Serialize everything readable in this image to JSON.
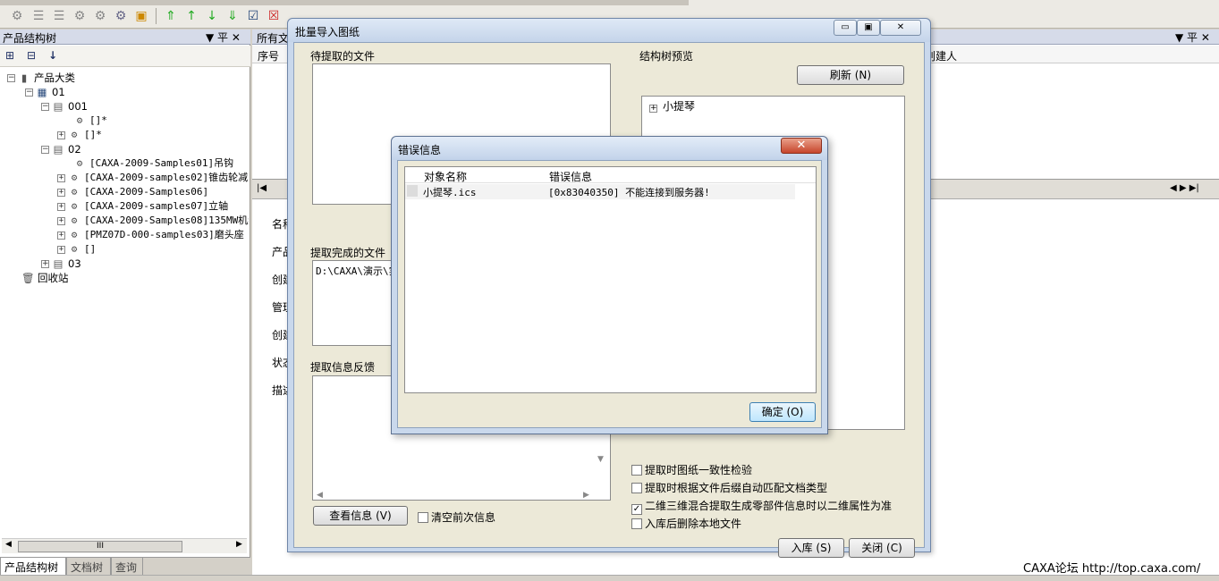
{
  "left_panel": {
    "title": "产品结构树",
    "pin": "▼ 平 ✕",
    "tree": [
      {
        "label": "产品大类"
      },
      {
        "label": "01"
      },
      {
        "label": "001"
      },
      {
        "label": "[]*"
      },
      {
        "label": "[]*"
      },
      {
        "label": "02"
      },
      {
        "label": "[CAXA-2009-Samples01]吊钩"
      },
      {
        "label": "[CAXA-2009-samples02]锥齿轮减"
      },
      {
        "label": "[CAXA-2009-Samples06]"
      },
      {
        "label": "[CAXA-2009-samples07]立轴"
      },
      {
        "label": "[CAXA-2009-Samples08]135MW机组"
      },
      {
        "label": "[PMZ07D-000-samples03]磨头座"
      },
      {
        "label": "[]"
      },
      {
        "label": "03"
      },
      {
        "label": "回收站"
      }
    ],
    "tabs": [
      "产品结构树",
      "文档树",
      "查询"
    ],
    "scroll_thumb": "III"
  },
  "right_top": {
    "header": "所有文",
    "col_index": "序号",
    "col_creator": "创建人"
  },
  "side_labels": [
    "名称",
    "产品",
    "创建",
    "管理",
    "创建",
    "状态",
    "描述"
  ],
  "batch_dialog": {
    "title": "批量导入图纸",
    "pending_files_label": "待提取的文件",
    "tree_preview_label": "结构树预览",
    "refresh_button": "刷新 (N)",
    "tree_preview_item": "小提琴",
    "done_files_label": "提取完成的文件",
    "done_files_item": "D:\\CAXA\\演示\\实",
    "feedback_label": "提取信息反馈",
    "view_info_button": "查看信息 (V)",
    "clear_prev_label": "清空前次信息",
    "options": [
      {
        "label": "提取时图纸一致性检验",
        "checked": false
      },
      {
        "label": "提取时根据文件后缀自动匹配文档类型",
        "checked": false
      },
      {
        "label": "二维三维混合提取生成零部件信息时以二维属性为准",
        "checked": true
      },
      {
        "label": "入库后删除本地文件",
        "checked": false
      }
    ],
    "store_button": "入库 (S)",
    "close_button": "关闭 (C)"
  },
  "error_dialog": {
    "title": "错误信息",
    "close_glyph": "✕",
    "col_object": "对象名称",
    "col_message": "错误信息",
    "rows": [
      {
        "object": "小提琴.ics",
        "message": "[0x83040350] 不能连接到服务器!"
      }
    ],
    "ok_button": "确定 (O)"
  },
  "watermark": "CAXA论坛 http://top.caxa.com/"
}
